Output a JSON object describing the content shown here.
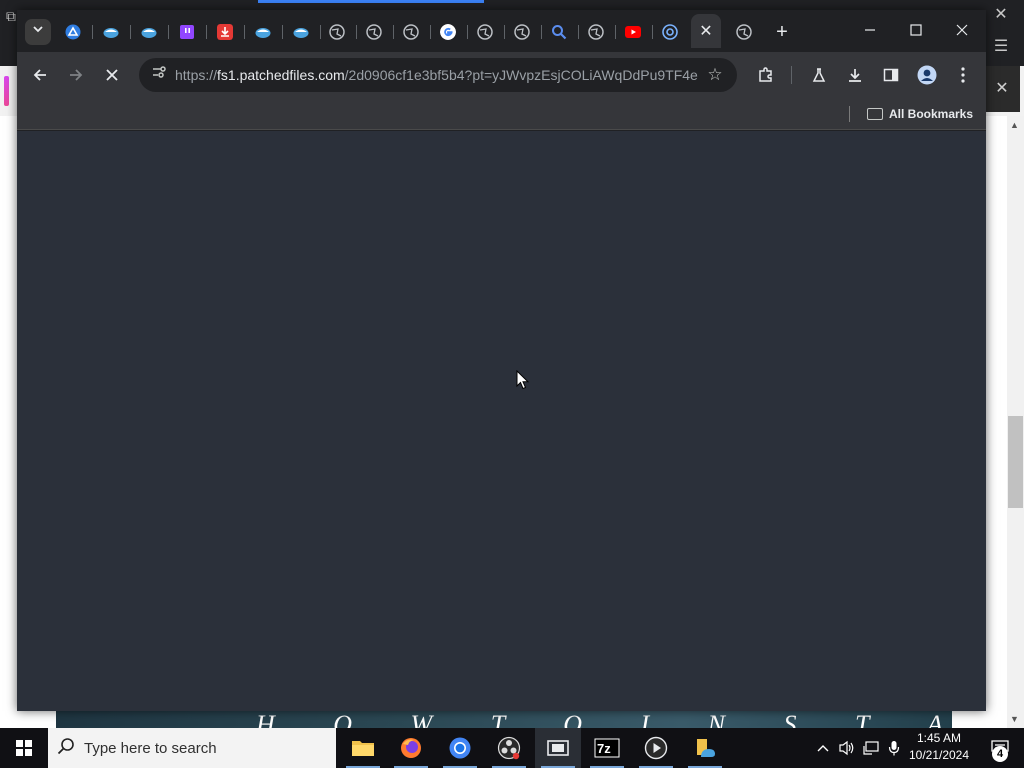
{
  "browser": {
    "tabs": [
      {
        "icon": "blue-circle-arrow-icon"
      },
      {
        "icon": "blue-bird-icon"
      },
      {
        "icon": "blue-bird-icon"
      },
      {
        "icon": "twitch-icon"
      },
      {
        "icon": "red-download-icon"
      },
      {
        "icon": "blue-bird-icon"
      },
      {
        "icon": "blue-bird-icon"
      },
      {
        "icon": "globe-icon"
      },
      {
        "icon": "globe-icon"
      },
      {
        "icon": "globe-icon"
      },
      {
        "icon": "google-icon"
      },
      {
        "icon": "globe-icon"
      },
      {
        "icon": "globe-icon"
      },
      {
        "icon": "search-icon"
      },
      {
        "icon": "globe-icon"
      },
      {
        "icon": "youtube-icon"
      },
      {
        "icon": "edge-swirl-icon"
      }
    ],
    "active_tab_close": "✕",
    "new_tab_label": "+",
    "address": {
      "scheme": "https://",
      "host": "fs1.patchedfiles.com",
      "path": "/2d0906cf1e3bf5b4?pt=yJWvpzEsjCOLiAWqDdPu9TF4e..."
    },
    "bookmarks_label": "All Bookmarks",
    "state": "loading"
  },
  "background_page": {
    "banner_text": "H O W   T O   I N S T A L L"
  },
  "taskbar": {
    "search_placeholder": "Type here to search",
    "apps": [
      "file-explorer",
      "firefox",
      "chrome",
      "obs",
      "video-editor",
      "7zip",
      "media-player",
      "weather"
    ],
    "clock_time": "1:45 AM",
    "clock_date": "10/21/2024",
    "notification_count": "4"
  },
  "colors": {
    "viewport": "#2b303a",
    "toolbar": "#35363a",
    "tabstrip": "#202124"
  }
}
